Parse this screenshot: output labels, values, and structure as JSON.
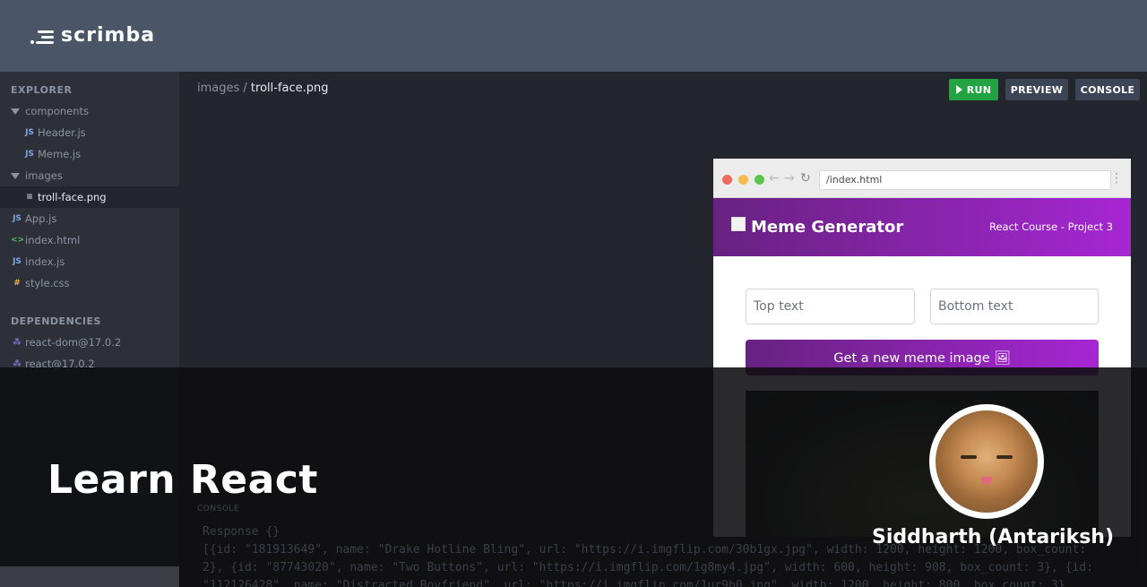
{
  "brand": {
    "name": "scrimba"
  },
  "sidebar": {
    "explorer_heading": "EXPLORER",
    "dependencies_heading": "DEPENDENCIES",
    "items": [
      {
        "label": "components",
        "type": "folder"
      },
      {
        "label": "Header.js",
        "type": "js",
        "icon": "JS"
      },
      {
        "label": "Meme.js",
        "type": "js",
        "icon": "JS"
      },
      {
        "label": "images",
        "type": "folder"
      },
      {
        "label": "troll-face.png",
        "type": "image",
        "active": true
      },
      {
        "label": "App.js",
        "type": "js",
        "icon": "JS"
      },
      {
        "label": "index.html",
        "type": "html",
        "icon": "<>"
      },
      {
        "label": "index.js",
        "type": "js",
        "icon": "JS"
      },
      {
        "label": "style.css",
        "type": "css",
        "icon": "#"
      }
    ],
    "dependencies": [
      {
        "label": "react-dom@17.0.2"
      },
      {
        "label": "react@17.0.2"
      }
    ]
  },
  "editor": {
    "breadcrumb_folder": "images /",
    "breadcrumb_file": "troll-face.png"
  },
  "toolbar": {
    "run_label": "RUN",
    "preview_label": "PREVIEW",
    "console_label": "CONSOLE"
  },
  "browser": {
    "url": "/index.html"
  },
  "meme_app": {
    "title": "Meme Generator",
    "subtitle": "React Course - Project 3",
    "top_placeholder": "Top text",
    "bottom_placeholder": "Bottom text",
    "button_label": "Get a new meme image 🖼"
  },
  "console": {
    "label": "CONSOLE",
    "lines": [
      "Response {}",
      "[{id: \"181913649\", name: \"Drake Hotline Bling\", url: \"https://i.imgflip.com/30b1gx.jpg\", width: 1200, height: 1200, box_count:",
      "2}, {id: \"87743020\", name: \"Two Buttons\", url: \"https://i.imgflip.com/1g8my4.jpg\", width: 600, height: 908, box_count: 3}, {id:",
      "\"112126428\", name: \"Distracted Boyfriend\", url: \"https://i.imgflip.com/1ur9b0.jpg\", width: 1200, height: 800, box_count: 3},"
    ]
  },
  "overlay": {
    "course_title": "Learn React",
    "instructor_name": "Siddharth (Antariksh)"
  },
  "colors": {
    "topbar": "#4a5568",
    "run": "#23a342",
    "meme_gradient_start": "#672280",
    "meme_gradient_end": "#a626d3"
  }
}
